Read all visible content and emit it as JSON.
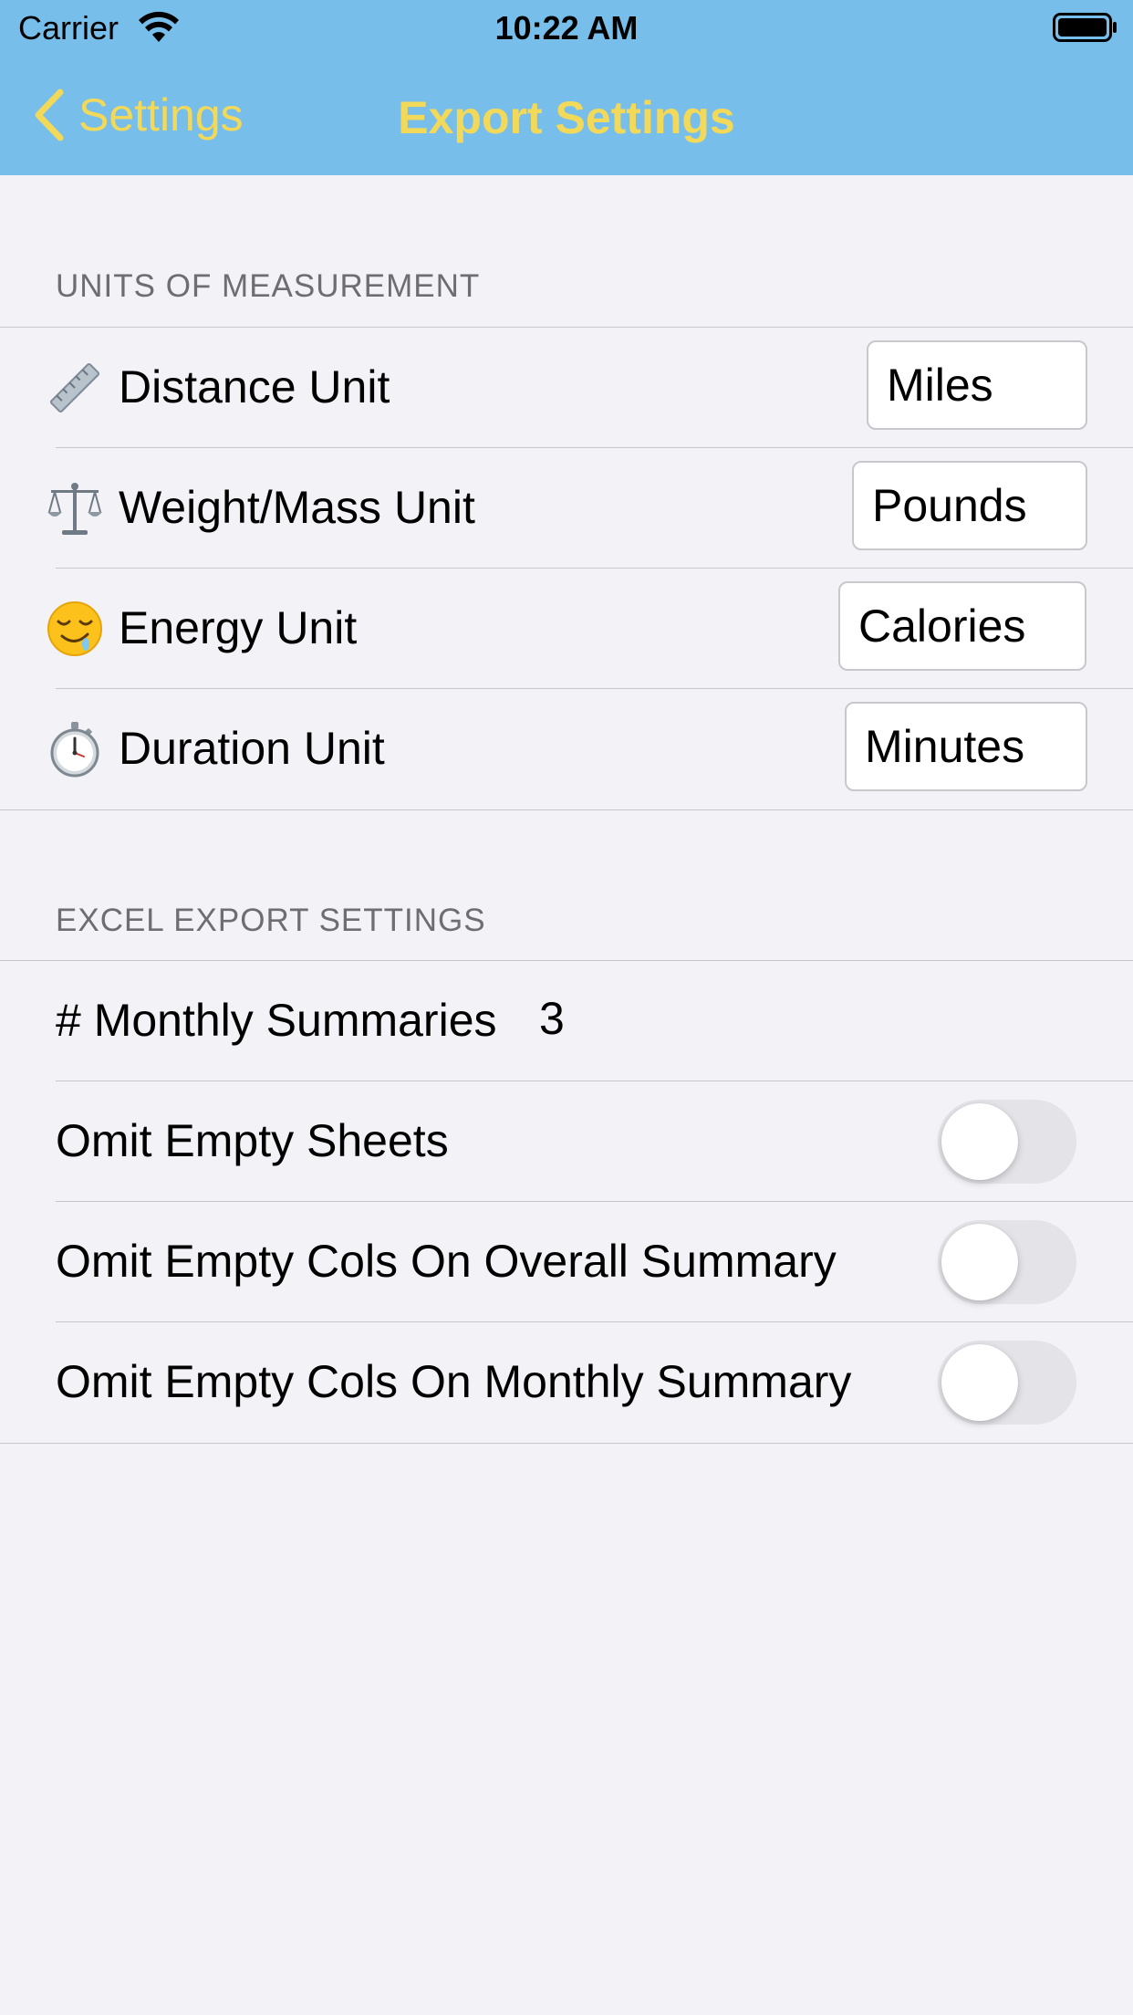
{
  "status_bar": {
    "carrier": "Carrier",
    "time": "10:22 AM"
  },
  "nav": {
    "back_label": "Settings",
    "title": "Export Settings",
    "tint_color": "#f3d95a",
    "bar_color": "#77bfea"
  },
  "units_section": {
    "header": "UNITS OF MEASUREMENT",
    "rows": [
      {
        "icon": "ruler-icon",
        "label": "Distance Unit",
        "value": "Miles"
      },
      {
        "icon": "scales-icon",
        "label": "Weight/Mass Unit",
        "value": "Pounds"
      },
      {
        "icon": "drooling-face-icon",
        "label": "Energy Unit",
        "value": "Calories"
      },
      {
        "icon": "stopwatch-icon",
        "label": "Duration Unit",
        "value": "Minutes"
      }
    ]
  },
  "excel_section": {
    "header": "EXCEL EXPORT SETTINGS",
    "monthly_summaries": {
      "label": "# Monthly Summaries",
      "value": "3"
    },
    "toggles": [
      {
        "label": "Omit Empty Sheets",
        "on": false
      },
      {
        "label": "Omit Empty Cols On Overall Summary",
        "on": false
      },
      {
        "label": "Omit Empty Cols On Monthly Summary",
        "on": false
      }
    ]
  }
}
